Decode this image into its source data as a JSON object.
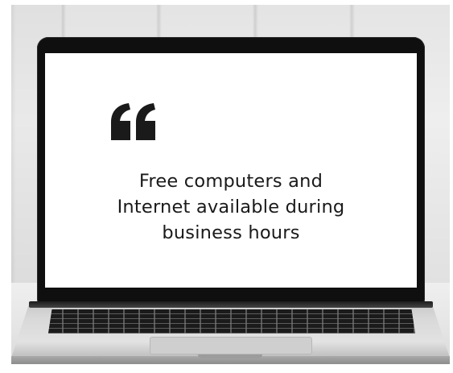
{
  "image": {
    "quote_icon": "quotation-mark-icon",
    "screen_text_lines": [
      "Free computers and",
      "Internet available during",
      "business hours"
    ],
    "colors": {
      "screen_background": "#ffffff",
      "text": "#1a1a1a",
      "bezel": "#0f0f0f"
    }
  }
}
